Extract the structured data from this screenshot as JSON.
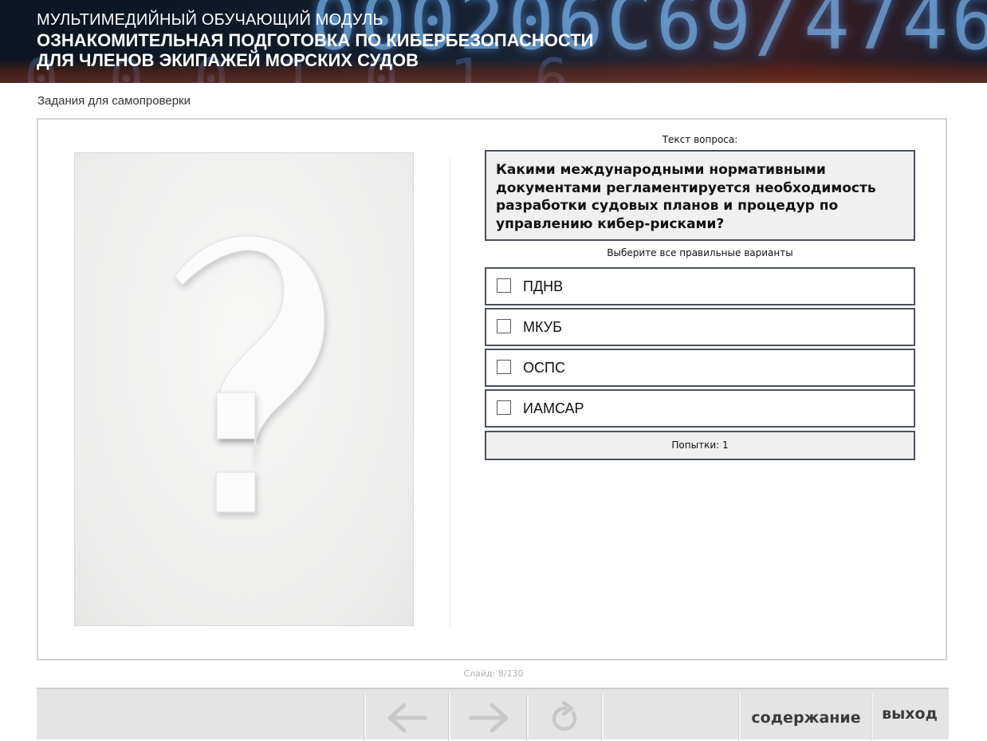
{
  "header": {
    "subtitle": "МУЛЬТИМЕДИЙНЫЙ ОБУЧАЮЩИЙ МОДУЛЬ",
    "title_line1": "ОЗНАКОМИТЕЛЬНАЯ ПОДГОТОВКА ПО КИБЕРБЕЗОПАСНОСТИ",
    "title_line2": "ДЛЯ ЧЛЕНОВ ЭКИПАЖЕЙ МОРСКИХ СУДОВ"
  },
  "section": {
    "label": "Задания для самопроверки"
  },
  "question": {
    "caption": "Текст вопроса:",
    "text": "Какими международными нормативными документами регламентируется необходимость разработки судовых планов и процедур по управлению кибер-рисками?",
    "hint": "Выберите все правильные варианты",
    "options": [
      {
        "label": "ПДНВ",
        "checked": false
      },
      {
        "label": "МКУБ",
        "checked": false
      },
      {
        "label": "ОСПС",
        "checked": false
      },
      {
        "label": "ИАМСАР",
        "checked": false
      }
    ],
    "attempts": "Попытки: 1"
  },
  "footer": {
    "slide_counter": "Слайд: 8/130",
    "contents_label": "содержание",
    "exit_label": "выход"
  },
  "icons": {
    "back": "arrow-left-icon",
    "forward": "arrow-right-icon",
    "reload": "reload-icon",
    "placeholder": "question-mark-icon"
  },
  "colors": {
    "border": "#4a525c",
    "panel_fill": "#f0f0f0",
    "nav_fill": "#e4e4e4",
    "icon_disabled": "#c8c8c8"
  }
}
